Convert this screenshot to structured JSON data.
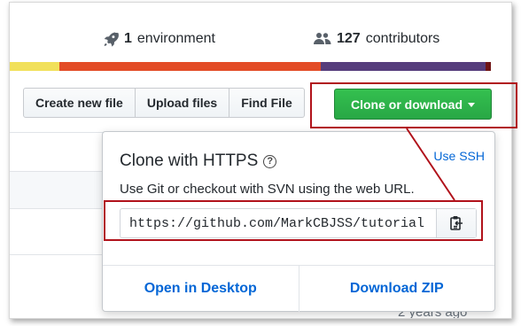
{
  "repo_summary": {
    "environments_count": "1",
    "environments_label": "environment",
    "contributors_count": "127",
    "contributors_label": "contributors"
  },
  "language_colors": [
    "#f1e05a",
    "#e34c26",
    "#563d7c",
    "#701516"
  ],
  "file_buttons": {
    "create": "Create new file",
    "upload": "Upload files",
    "find": "Find File"
  },
  "clone_button": {
    "label": "Clone or download"
  },
  "clone_popup": {
    "title": "Clone with HTTPS",
    "help_icon": "?",
    "use_ssh": "Use SSH",
    "description": "Use Git or checkout with SVN using the web URL.",
    "url": "https://github.com/MarkCBJSS/tutorial",
    "open_desktop": "Open in Desktop",
    "download_zip": "Download ZIP"
  },
  "file_list": {
    "last_age": "2 years ago"
  },
  "annotation_color": "#b1121b"
}
